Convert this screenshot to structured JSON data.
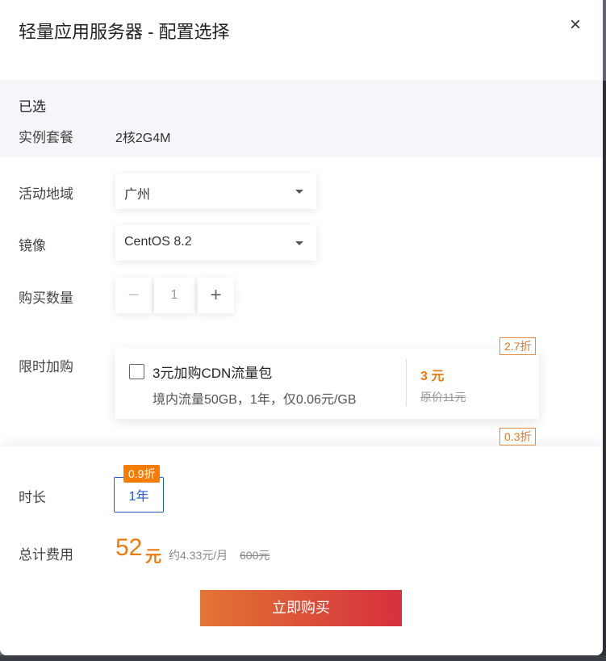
{
  "dialog": {
    "title": "轻量应用服务器 - 配置选择",
    "close_label": "×"
  },
  "selected": {
    "heading": "已选",
    "package_label": "实例套餐",
    "package_value": "2核2G4M"
  },
  "region": {
    "label": "活动地域",
    "value": "广州"
  },
  "image": {
    "label": "镜像",
    "value": "CentOS 8.2"
  },
  "quantity": {
    "label": "购买数量",
    "minus": "−",
    "value": "1",
    "plus": "+"
  },
  "promo": {
    "label": "限时加购",
    "discount_tag": "2.7折",
    "title": "3元加购CDN流量包",
    "description": "境内流量50GB，1年，仅0.06元/GB",
    "price": "3 元",
    "original_price": "原价11元",
    "next_discount_tag": "0.3折"
  },
  "duration": {
    "label": "时长",
    "badge": "0.9折",
    "option": "1年"
  },
  "total": {
    "label": "总计费用",
    "amount": "52",
    "unit": "元",
    "monthly": "约4.33元/月",
    "original": "600元"
  },
  "buy_button": "立即购买",
  "colors": {
    "accent_orange": "#ed7b0c",
    "selected_blue": "#1f5ad6",
    "button_start": "#e27533",
    "button_end": "#d5303e"
  }
}
